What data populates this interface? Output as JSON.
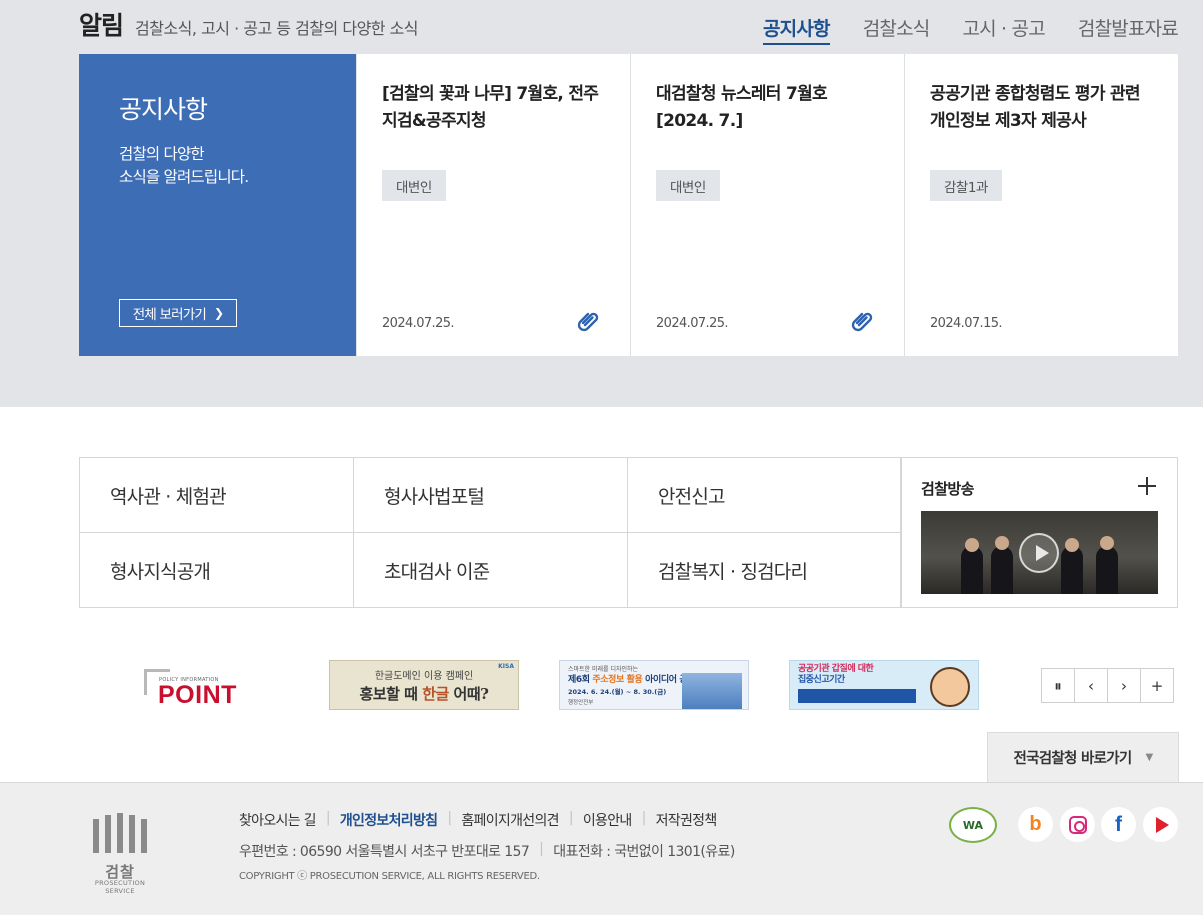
{
  "notice": {
    "title": "알림",
    "description": "검찰소식, 고시 · 공고 등 검찰의 다양한 소식",
    "tabs": [
      {
        "label": "공지사항",
        "active": true
      },
      {
        "label": "검찰소식",
        "active": false
      },
      {
        "label": "고시 · 공고",
        "active": false
      },
      {
        "label": "검찰발표자료",
        "active": false
      }
    ],
    "intro": {
      "title": "공지사항",
      "desc_line1": "검찰의 다양한",
      "desc_line2": "소식을 알려드립니다.",
      "view_all": "전체 보러가기"
    },
    "cards": [
      {
        "title": "[검찰의 꽃과 나무] 7월호, 전주지검&공주지청",
        "tag": "대변인",
        "date": "2024.07.25.",
        "attachment": true
      },
      {
        "title": "대검찰청 뉴스레터 7월호 [2024. 7.]",
        "tag": "대변인",
        "date": "2024.07.25.",
        "attachment": true
      },
      {
        "title": "공공기관 종합청렴도 평가 관련 개인정보 제3자 제공사",
        "tag": "감찰1과",
        "date": "2024.07.15.",
        "attachment": false
      }
    ]
  },
  "quick_links": [
    {
      "label": "역사관 · 체험관"
    },
    {
      "label": "형사사법포털"
    },
    {
      "label": "안전신고"
    },
    {
      "label": "형사지식공개"
    },
    {
      "label": "초대검사 이준"
    },
    {
      "label": "검찰복지 · 징검다리"
    }
  ],
  "broadcast": {
    "title": "검찰방송"
  },
  "banners": {
    "point": {
      "small": "POLICY INFORMATION",
      "word": "POINT"
    },
    "hangul": {
      "top": "한글도메인 이용 캠페인",
      "main_a": "홍보할 때 ",
      "main_accent": "한글",
      "main_b": " 어때?",
      "tag": "KISA"
    },
    "contest": {
      "small": "스마트한 미래를 디자인하는",
      "main_a": "제6회 ",
      "main_orange": "주소정보 활용",
      "main_b": " 아이디어 공모전",
      "date": "2024. 6. 24.(월) ~ 8. 30.(금)",
      "logo": "행정안전부"
    },
    "report": {
      "line1": "공공기관 갑질에 대한",
      "line2": "집중신고기간"
    }
  },
  "slider_controls": {
    "pause": "⏸",
    "prev": "‹",
    "next": "›",
    "more": "+"
  },
  "nation_button": {
    "label": "전국검찰청 바로가기",
    "arrow": "▼"
  },
  "footer": {
    "logo_ko": "검찰",
    "logo_en": "PROSECUTION SERVICE",
    "links": [
      "찾아오시는 길",
      "개인정보처리방침",
      "홈페이지개선의견",
      "이용안내",
      "저작권정책"
    ],
    "address": "우편번호 : 06590 서울특별시 서초구 반포대로 157",
    "phone": "대표전화 : 국번없이 1301(유료)",
    "copyright": "COPYRIGHT ⓒ PROSECUTION SERVICE, ALL RIGHTS RESERVED.",
    "wa_badge": "WA",
    "social_icons": [
      "blog-icon",
      "instagram-icon",
      "facebook-icon",
      "youtube-icon"
    ]
  },
  "colors": {
    "accent": "#3d6db5",
    "tab_active": "#1e4f8f",
    "section_bg": "#e2e4e8"
  }
}
